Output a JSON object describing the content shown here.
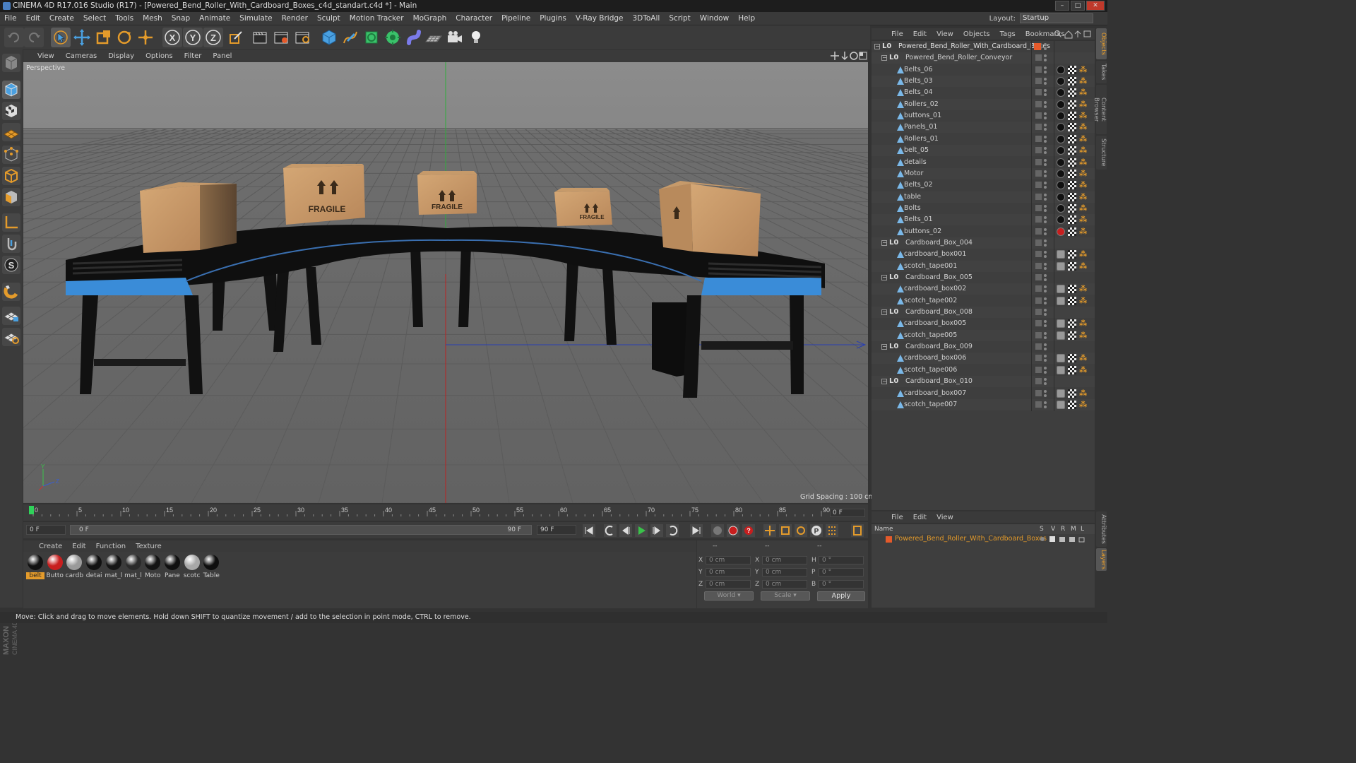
{
  "window": {
    "title": "CINEMA 4D R17.016 Studio (R17) - [Powered_Bend_Roller_With_Cardboard_Boxes_c4d_standart.c4d *] - Main"
  },
  "menubar": {
    "items": [
      "File",
      "Edit",
      "Create",
      "Select",
      "Tools",
      "Mesh",
      "Snap",
      "Animate",
      "Simulate",
      "Render",
      "Sculpt",
      "Motion Tracker",
      "MoGraph",
      "Character",
      "Pipeline",
      "Plugins",
      "V-Ray Bridge",
      "3DToAll",
      "Script",
      "Window",
      "Help"
    ],
    "layout_label": "Layout:",
    "layout_value": "Startup"
  },
  "viewport": {
    "menu": [
      "View",
      "Cameras",
      "Display",
      "Options",
      "Filter",
      "Panel"
    ],
    "label": "Perspective",
    "grid_spacing": "Grid Spacing : 100 cm",
    "box_text": "FRAGILE"
  },
  "object_manager": {
    "menu": [
      "File",
      "Edit",
      "View",
      "Objects",
      "Tags",
      "Bookmarks"
    ],
    "rows": [
      {
        "name": "Powered_Bend_Roller_With_Cardboard_Boxes",
        "level": 0,
        "type": "null"
      },
      {
        "name": "Powered_Bend_Roller_Conveyor",
        "level": 1,
        "type": "null"
      },
      {
        "name": "Belts_06",
        "level": 2,
        "type": "mesh"
      },
      {
        "name": "Belts_03",
        "level": 2,
        "type": "mesh"
      },
      {
        "name": "Belts_04",
        "level": 2,
        "type": "mesh"
      },
      {
        "name": "Rollers_02",
        "level": 2,
        "type": "mesh"
      },
      {
        "name": "buttons_01",
        "level": 2,
        "type": "mesh"
      },
      {
        "name": "Panels_01",
        "level": 2,
        "type": "mesh"
      },
      {
        "name": "Rollers_01",
        "level": 2,
        "type": "mesh"
      },
      {
        "name": "belt_05",
        "level": 2,
        "type": "mesh"
      },
      {
        "name": "details",
        "level": 2,
        "type": "mesh"
      },
      {
        "name": "Motor",
        "level": 2,
        "type": "mesh"
      },
      {
        "name": "Belts_02",
        "level": 2,
        "type": "mesh"
      },
      {
        "name": "table",
        "level": 2,
        "type": "mesh"
      },
      {
        "name": "Bolts",
        "level": 2,
        "type": "mesh"
      },
      {
        "name": "Belts_01",
        "level": 2,
        "type": "mesh"
      },
      {
        "name": "buttons_02",
        "level": 2,
        "type": "mesh"
      },
      {
        "name": "Cardboard_Box_004",
        "level": 1,
        "type": "null"
      },
      {
        "name": "cardboard_box001",
        "level": 2,
        "type": "mesh"
      },
      {
        "name": "scotch_tape001",
        "level": 2,
        "type": "mesh"
      },
      {
        "name": "Cardboard_Box_005",
        "level": 1,
        "type": "null"
      },
      {
        "name": "cardboard_box002",
        "level": 2,
        "type": "mesh"
      },
      {
        "name": "scotch_tape002",
        "level": 2,
        "type": "mesh"
      },
      {
        "name": "Cardboard_Box_008",
        "level": 1,
        "type": "null"
      },
      {
        "name": "cardboard_box005",
        "level": 2,
        "type": "mesh"
      },
      {
        "name": "scotch_tape005",
        "level": 2,
        "type": "mesh"
      },
      {
        "name": "Cardboard_Box_009",
        "level": 1,
        "type": "null"
      },
      {
        "name": "cardboard_box006",
        "level": 2,
        "type": "mesh"
      },
      {
        "name": "scotch_tape006",
        "level": 2,
        "type": "mesh"
      },
      {
        "name": "Cardboard_Box_010",
        "level": 1,
        "type": "null"
      },
      {
        "name": "cardboard_box007",
        "level": 2,
        "type": "mesh"
      },
      {
        "name": "scotch_tape007",
        "level": 2,
        "type": "mesh"
      }
    ]
  },
  "side_tabs": [
    "Objects",
    "Takes",
    "Content Browser",
    "Structure"
  ],
  "side_tabs_lower": [
    "Attributes",
    "Layers"
  ],
  "timeline": {
    "ticks": [
      "0",
      "5",
      "10",
      "15",
      "20",
      "25",
      "30",
      "35",
      "40",
      "45",
      "50",
      "55",
      "60",
      "65",
      "70",
      "75",
      "80",
      "85",
      "90"
    ],
    "current_frame_right": "0 F",
    "start_field": "0 F",
    "range_start": "0 F",
    "range_end": "90 F",
    "end_field": "90 F"
  },
  "materials": {
    "menu": [
      "Create",
      "Edit",
      "Function",
      "Texture"
    ],
    "items": [
      {
        "label": "belt",
        "color": "#111111",
        "selected": true
      },
      {
        "label": "Butto",
        "color": "#c81e1e",
        "selected": false
      },
      {
        "label": "cardb",
        "color": "#9a9a9a",
        "selected": false
      },
      {
        "label": "detai",
        "color": "#111111",
        "selected": false
      },
      {
        "label": "mat_l",
        "color": "#151515",
        "selected": false
      },
      {
        "label": "mat_l",
        "color": "#2a2a2a",
        "selected": false
      },
      {
        "label": "Moto",
        "color": "#141414",
        "selected": false
      },
      {
        "label": "Pane",
        "color": "#101010",
        "selected": false
      },
      {
        "label": "scotc",
        "color": "#a8a8a8",
        "selected": false
      },
      {
        "label": "Table",
        "color": "#0e0e0e",
        "selected": false
      }
    ]
  },
  "coordinates": {
    "header": [
      "--",
      "--",
      "--"
    ],
    "rows": [
      {
        "a": "X",
        "av": "0 cm",
        "b": "X",
        "bv": "0 cm",
        "c": "H",
        "cv": "0 °"
      },
      {
        "a": "Y",
        "av": "0 cm",
        "b": "Y",
        "bv": "0 cm",
        "c": "P",
        "cv": "0 °"
      },
      {
        "a": "Z",
        "av": "0 cm",
        "b": "Z",
        "bv": "0 cm",
        "c": "B",
        "cv": "0 °"
      }
    ],
    "space": "World",
    "mode": "Scale",
    "apply": "Apply"
  },
  "layers": {
    "menu": [
      "File",
      "Edit",
      "View"
    ],
    "columns": {
      "name": "Name",
      "flags": [
        "S",
        "V",
        "R",
        "M",
        "L"
      ]
    },
    "rows": [
      {
        "name": "Powered_Bend_Roller_With_Cardboard_Boxes"
      }
    ]
  },
  "status": "Move: Click and drag to move elements. Hold down SHIFT to quantize movement / add to the selection in point mode, CTRL to remove.",
  "colors": {
    "accent": "#e49b2b",
    "selection": "#e49b2b",
    "button_red": "#c81e1e"
  }
}
